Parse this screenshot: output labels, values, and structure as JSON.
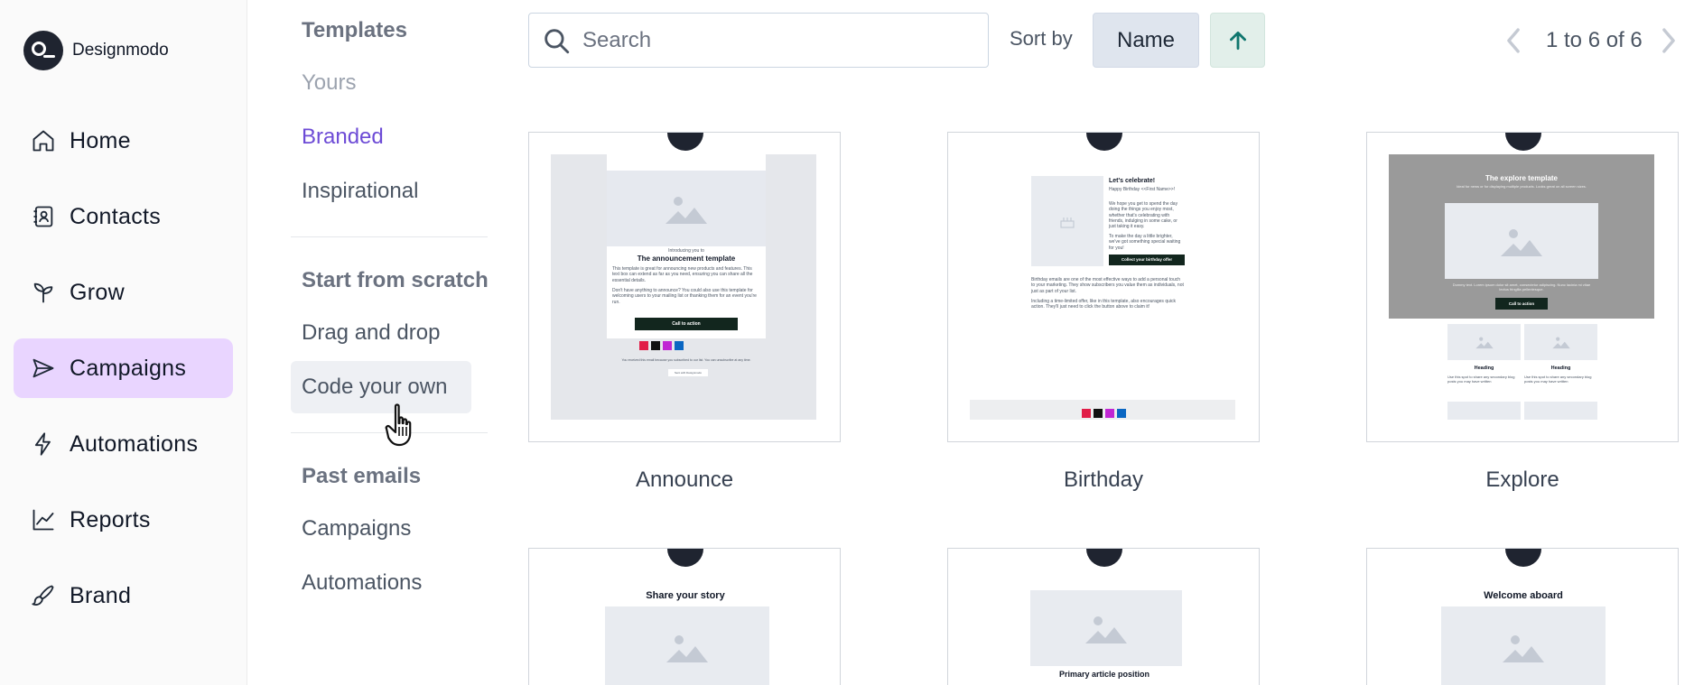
{
  "brand": {
    "name": "Designmodo"
  },
  "nav": {
    "items": [
      {
        "label": "Home",
        "icon": "home-icon"
      },
      {
        "label": "Contacts",
        "icon": "contacts-icon"
      },
      {
        "label": "Grow",
        "icon": "sprout-icon"
      },
      {
        "label": "Campaigns",
        "icon": "send-icon",
        "active": true
      },
      {
        "label": "Automations",
        "icon": "lightning-icon"
      },
      {
        "label": "Reports",
        "icon": "chart-icon"
      },
      {
        "label": "Brand",
        "icon": "brush-icon"
      }
    ]
  },
  "categories": {
    "templates_heading": "Templates",
    "templates": [
      "Yours",
      "Branded",
      "Inspirational"
    ],
    "scratch_heading": "Start from scratch",
    "scratch": [
      "Drag and drop",
      "Code your own"
    ],
    "past_heading": "Past emails",
    "past": [
      "Campaigns",
      "Automations"
    ]
  },
  "toolbar": {
    "search_placeholder": "Search",
    "sort_label": "Sort by",
    "sort_value": "Name",
    "pagination": "1 to 6 of 6"
  },
  "templates": [
    {
      "name": "Announce"
    },
    {
      "name": "Birthday"
    },
    {
      "name": "Explore"
    }
  ],
  "previews": {
    "announce": {
      "kicker": "Introducing you to",
      "title": "The announcement template",
      "body1": "This template is great for announcing new products and features. This text box can extend as far as you need, ensuring you can share all the essential details.",
      "body2": "Don't have anything to announce? You could also use this template for welcoming users to your mailing list or thanking them for an event you're run.",
      "cta": "Call to action",
      "footer": "You received this email because you subscribed to our list. You can unsubscribe at any time.",
      "badge": "Sent with Designmodo"
    },
    "birthday": {
      "title": "Let's celebrate!",
      "greeting": "Happy Birthday <<First Name>>!",
      "body1": "We hope you get to spend the day doing the things you enjoy most, whether that's celebrating with friends, indulging in some cake, or just taking it easy.",
      "body2": "To make the day a little brighter, we've got something special waiting for you!",
      "cta": "Collect your birthday offer",
      "body3": "Birthday emails are one of the most effective ways to add a personal touch to your marketing. They show subscribers you value them as individuals, not just as part of your list.",
      "body4": "Including a time-limited offer, like in this template, also encourages quick action. They'll just need to click the button above to claim it!"
    },
    "explore": {
      "title": "The explore template",
      "subtitle": "Ideal for news or for displaying multiple products. Looks great on all screen sizes.",
      "body": "Dummy text. Lorem ipsum dolor sit amet, consectetur adipiscing. Nunc lacinia mi vitae lectus fringilla pellentesque.",
      "cta": "Call to action",
      "heading": "Heading",
      "blurb": "Use this spot to share any secondary blog posts you may have written"
    },
    "row2": {
      "story_title": "Share your story",
      "article_caption": "Primary article position",
      "welcome_title": "Welcome aboard"
    }
  },
  "colors": {
    "active_nav": "#e9d5ff",
    "selected_category": "#6d4bd6",
    "sort_name_bg": "#dfe5ee",
    "sort_dir_bg": "#e2efea",
    "sort_dir_arrow": "#0f766e"
  }
}
